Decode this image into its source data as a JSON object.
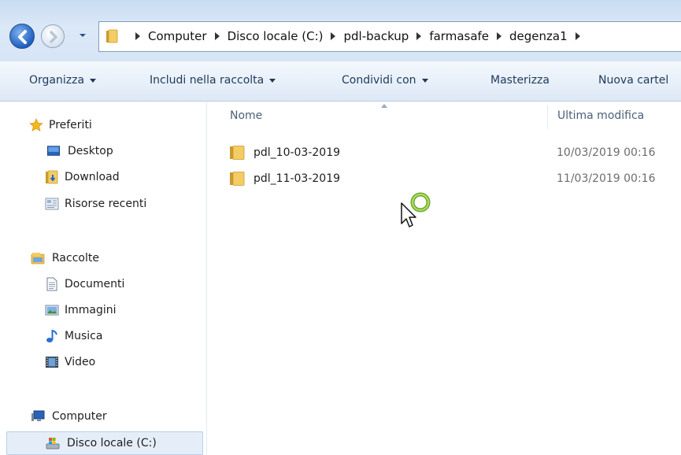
{
  "address_bar": {
    "breadcrumbs": [
      "Computer",
      "Disco locale (C:)",
      "pdl-backup",
      "farmasafe",
      "degenza1"
    ]
  },
  "toolbar": {
    "organize": "Organizza",
    "include_library": "Includi nella raccolta",
    "share_with": "Condividi con",
    "burn": "Masterizza",
    "new_folder": "Nuova cartel"
  },
  "navigation": {
    "favorites": {
      "label": "Preferiti",
      "items": [
        "Desktop",
        "Download",
        "Risorse recenti"
      ]
    },
    "libraries": {
      "label": "Raccolte",
      "items": [
        "Documenti",
        "Immagini",
        "Musica",
        "Video"
      ]
    },
    "computer": {
      "label": "Computer",
      "items": [
        "Disco locale (C:)"
      ]
    }
  },
  "columns": {
    "name": "Nome",
    "modified": "Ultima modifica"
  },
  "files": [
    {
      "name": "pdl_10-03-2019",
      "modified": "10/03/2019 00:16",
      "icon": "folder-icon"
    },
    {
      "name": "pdl_11-03-2019",
      "modified": "11/03/2019 00:16",
      "icon": "folder-icon"
    }
  ],
  "colors": {
    "chrome_top": "#c9dcf2",
    "toolbar_text": "#1e395b",
    "folder": "#e8b84a",
    "selection": "#e5eef8"
  }
}
